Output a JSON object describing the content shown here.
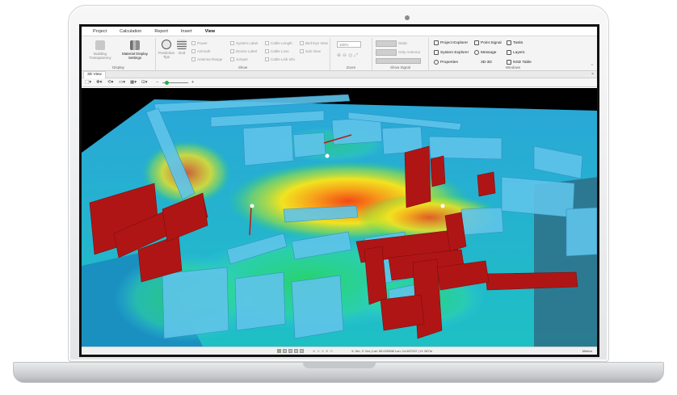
{
  "ribbon_tabs": [
    "Project",
    "Calculation",
    "Report",
    "Insert",
    "View"
  ],
  "active_tab": "View",
  "display_group": {
    "label": "Display",
    "building_transparency": "Building Transparency",
    "material_display_settings_1": "Material Display",
    "material_display_settings_2": "Settings"
  },
  "show_group": {
    "label": "Show",
    "prediction_tips": "Prediction Tips",
    "grid": "Grid",
    "checkboxes": [
      "Power",
      "Azimuth",
      "Antenna Range",
      "System Label",
      "Device Label",
      "Jumper",
      "Cable Length",
      "Cable Loss",
      "Cable Link Info",
      "Bird Eye View",
      "Sub View"
    ]
  },
  "zoom_group": {
    "label": "Zoom",
    "value": "100%"
  },
  "show_signal_group": {
    "label": "Show Signal",
    "static": "Static",
    "only_antenna": "Only Antenna"
  },
  "windows_group": {
    "label": "Windows",
    "items": [
      "Project Explorer",
      "Point Signal",
      "Tasks",
      "System Explorer",
      "Message",
      "Layers",
      "Properties",
      "3D-3D",
      "NSD Table"
    ]
  },
  "view_tab": "3D View",
  "status_bar": {
    "coords": "X: 0m, Y: 0m | Lat: 59.020998 Lon: 14.827237 | H: 267m",
    "units": "Meters"
  },
  "colors": {
    "wall_red": "#b01515",
    "coverage_cyan": "#33c6e6",
    "coverage_green": "#27d36a",
    "coverage_yellow": "#f2e320",
    "coverage_red": "#f24a16"
  }
}
